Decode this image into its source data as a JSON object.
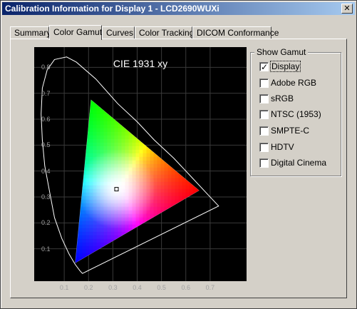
{
  "window": {
    "title": "Calibration Information for Display 1 - LCD2690WUXi",
    "close_glyph": "✕"
  },
  "tabs": [
    {
      "label": "Summary",
      "active": false
    },
    {
      "label": "Color Gamut",
      "active": true
    },
    {
      "label": "Curves",
      "active": false
    },
    {
      "label": "Color Tracking",
      "active": false
    },
    {
      "label": "DICOM Conformance",
      "active": false
    }
  ],
  "show_gamut": {
    "label": "Show Gamut",
    "options": [
      {
        "label": "Display",
        "checked": true
      },
      {
        "label": "Adobe RGB",
        "checked": false
      },
      {
        "label": "sRGB",
        "checked": false
      },
      {
        "label": "NTSC (1953)",
        "checked": false
      },
      {
        "label": "SMPTE-C",
        "checked": false
      },
      {
        "label": "HDTV",
        "checked": false
      },
      {
        "label": "Digital Cinema",
        "checked": false
      }
    ]
  },
  "chart_data": {
    "type": "scatter",
    "title": "CIE 1931 xy",
    "xlim": [
      0.0,
      0.8
    ],
    "ylim": [
      0.0,
      0.9
    ],
    "xticks": [
      "0.1",
      "0.2",
      "0.3",
      "0.4",
      "0.5",
      "0.6",
      "0.7"
    ],
    "yticks": [
      "0.1",
      "0.2",
      "0.3",
      "0.4",
      "0.5",
      "0.6",
      "0.7",
      "0.8"
    ],
    "grid": true,
    "gamut_triangle": {
      "red": [
        0.655,
        0.325
      ],
      "green": [
        0.21,
        0.675
      ],
      "blue": [
        0.145,
        0.045
      ]
    },
    "white_point": [
      0.315,
      0.33
    ],
    "spectral_locus": [
      [
        0.175,
        0.005
      ],
      [
        0.165,
        0.015
      ],
      [
        0.145,
        0.04
      ],
      [
        0.12,
        0.08
      ],
      [
        0.09,
        0.14
      ],
      [
        0.06,
        0.22
      ],
      [
        0.04,
        0.32
      ],
      [
        0.02,
        0.42
      ],
      [
        0.01,
        0.52
      ],
      [
        0.005,
        0.62
      ],
      [
        0.01,
        0.72
      ],
      [
        0.03,
        0.79
      ],
      [
        0.06,
        0.83
      ],
      [
        0.11,
        0.84
      ],
      [
        0.15,
        0.82
      ],
      [
        0.23,
        0.755
      ],
      [
        0.32,
        0.66
      ],
      [
        0.4,
        0.59
      ],
      [
        0.47,
        0.52
      ],
      [
        0.55,
        0.45
      ],
      [
        0.62,
        0.38
      ],
      [
        0.68,
        0.32
      ],
      [
        0.735,
        0.265
      ],
      [
        0.175,
        0.005
      ]
    ]
  }
}
